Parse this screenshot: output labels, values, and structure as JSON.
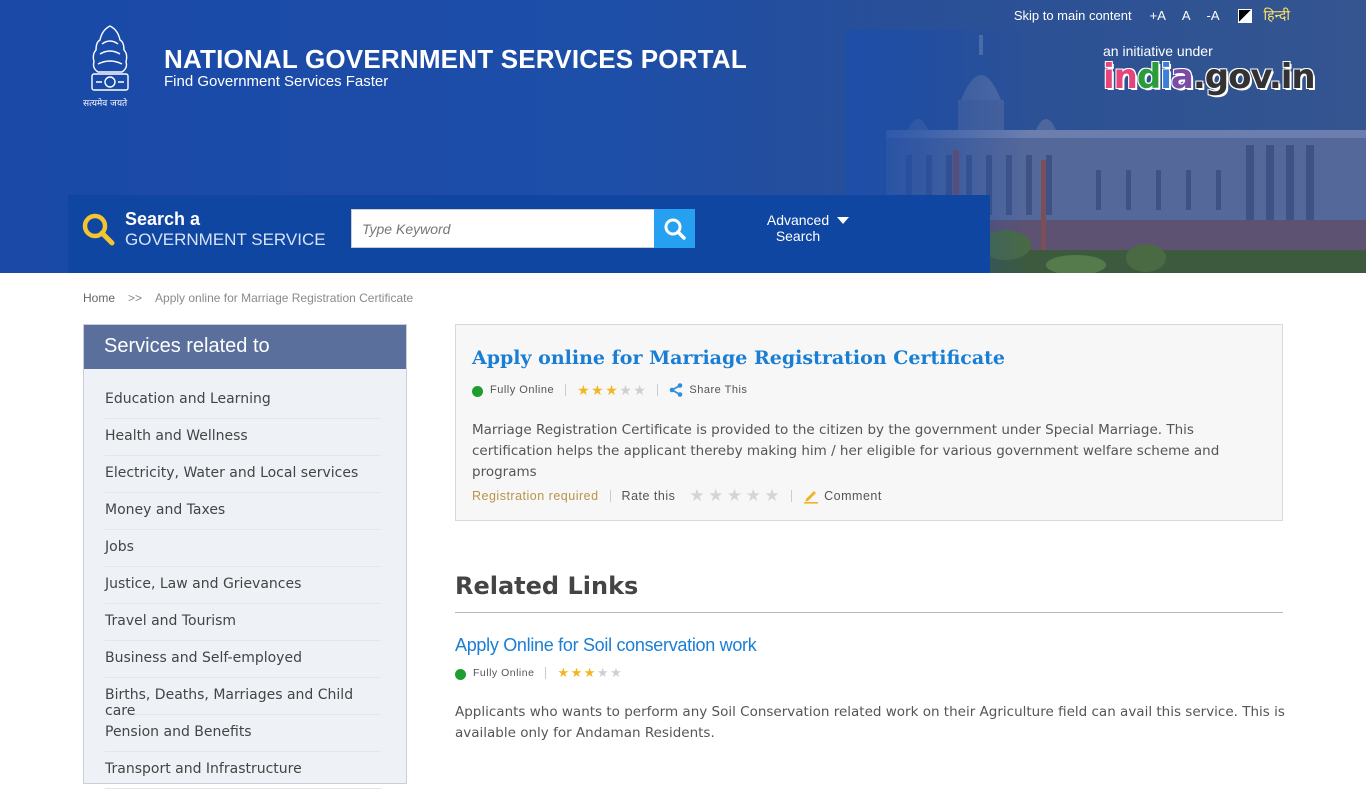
{
  "topbar": {
    "skip_link": "Skip to main content",
    "font_increase": "+A",
    "font_normal": "A",
    "font_decrease": "-A",
    "language": "हिन्दी"
  },
  "header": {
    "emblem_caption": "सत्यमेव जयते",
    "title": "NATIONAL GOVERNMENT SERVICES PORTAL",
    "subtitle": "Find Government Services Faster",
    "initiative_text": "an initiative under",
    "initiative_logo": [
      "in",
      "d",
      "i",
      "a",
      ".gov.in"
    ]
  },
  "search": {
    "label_line1": "Search a",
    "label_line2": "GOVERNMENT SERVICE",
    "placeholder": "Type Keyword",
    "value": "",
    "advanced_line1": "Advanced",
    "advanced_line2": "Search"
  },
  "breadcrumb": {
    "home": "Home",
    "separator": ">>",
    "current": "Apply online for Marriage Registration Certificate"
  },
  "sidebar": {
    "heading": "Services related to",
    "items": [
      {
        "label": "Education and Learning"
      },
      {
        "label": "Health and Wellness"
      },
      {
        "label": "Electricity, Water and Local services"
      },
      {
        "label": "Money and Taxes"
      },
      {
        "label": "Jobs"
      },
      {
        "label": "Justice, Law and Grievances"
      },
      {
        "label": "Travel and Tourism"
      },
      {
        "label": "Business and Self-employed"
      },
      {
        "label": "Births, Deaths, Marriages and Child care"
      },
      {
        "label": "Pension and Benefits"
      },
      {
        "label": "Transport and Infrastructure"
      }
    ]
  },
  "service": {
    "title": "Apply online for Marriage Registration Certificate",
    "status": "Fully Online",
    "status_color": "#1e9e2e",
    "rating": 3,
    "rating_max": 5,
    "share_label": "Share This",
    "description": "Marriage Registration Certificate is provided to the citizen by the government under Special Marriage. This certification helps the applicant thereby making him / her eligible for various government welfare scheme and programs",
    "registration_note": "Registration required",
    "rate_label": "Rate this",
    "user_rating": 0,
    "comment_label": "Comment"
  },
  "related": {
    "heading": "Related Links",
    "items": [
      {
        "title": "Apply Online for Soil conservation work",
        "status": "Fully Online",
        "rating": 3,
        "rating_max": 5,
        "description": "Applicants who wants to perform any Soil Conservation related work on their Agriculture field can avail this service. This is available only for Andaman Residents."
      }
    ]
  },
  "colors": {
    "header_blue": "#1a49a8",
    "search_bar_blue": "#0e46a1",
    "search_button": "#26a0f0",
    "link_blue": "#1a7ed4",
    "sidebar_head": "#5a6f9b",
    "star_active": "#f2b622",
    "hindi_yellow": "#ffe36a"
  }
}
